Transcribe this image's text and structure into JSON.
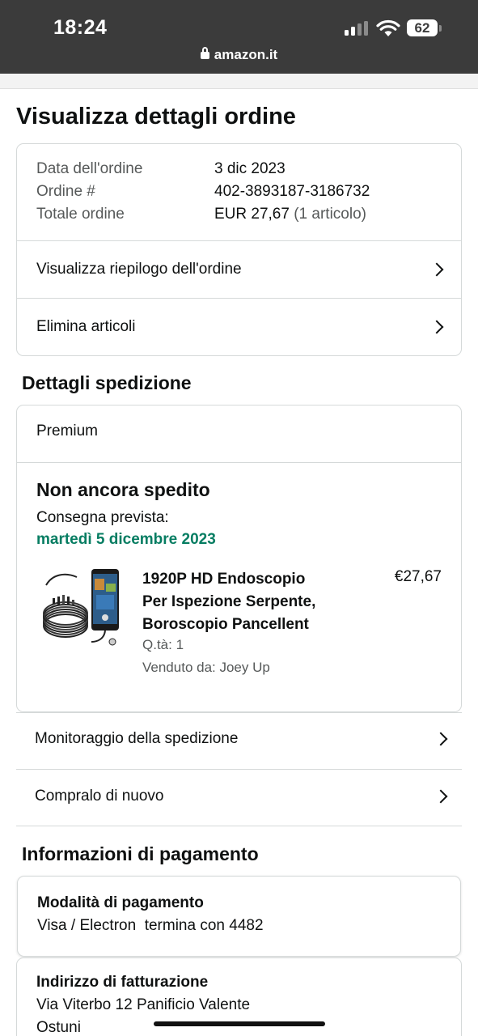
{
  "status_bar": {
    "time": "18:24",
    "battery": "62",
    "url": "amazon.it"
  },
  "page": {
    "title": "Visualizza dettagli ordine"
  },
  "order_summary": {
    "date_label": "Data dell'ordine",
    "date_value": "3 dic 2023",
    "order_label": "Ordine #",
    "order_value": "402-3893187-3186732",
    "total_label": "Totale ordine",
    "total_value": "EUR 27,67",
    "total_items": "(1 articolo)",
    "summary_link": "Visualizza riepilogo dell'ordine",
    "delete_link": "Elimina articoli"
  },
  "shipping": {
    "heading": "Dettagli spedizione",
    "service": "Premium",
    "status": "Non ancora spedito",
    "delivery_label": "Consegna prevista:",
    "delivery_date": "martedì 5 dicembre 2023",
    "item": {
      "title_line1": "1920P HD Endoscopio",
      "title_line2": "Per Ispezione Serpente,",
      "title_line3": "Boroscopio Pancellent",
      "price": "€27,67",
      "quantity": "Q.tà: 1",
      "seller": "Venduto da: Joey Up"
    },
    "track_link": "Monitoraggio della spedizione",
    "buy_again_link": "Compralo di nuovo"
  },
  "payment": {
    "heading": "Informazioni di pagamento",
    "method_label": "Modalità di pagamento",
    "method_value": "Visa / Electron  termina con 4482",
    "billing_label": "Indirizzo di fatturazione",
    "billing_line1": "Via Viterbo 12 Panificio Valente",
    "billing_line2": "Ostuni"
  },
  "colors": {
    "status_bar_bg": "#3b3b3b",
    "delivery_green": "#067d62",
    "border": "#d5d9d9"
  }
}
